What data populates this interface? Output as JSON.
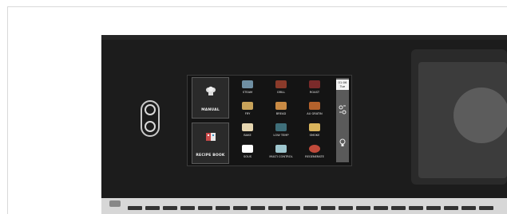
{
  "oven_panel": {
    "mode_buttons": [
      {
        "label": "MANUAL",
        "icon": "chef-hat-icon"
      },
      {
        "label": "RECIPE BOOK",
        "icon": "book-icon"
      }
    ],
    "programs": [
      {
        "label": "STEAM",
        "icon": "steam-icon",
        "color": "#6f8fa3"
      },
      {
        "label": "GRILL",
        "icon": "grill-icon",
        "color": "#8a3a2a"
      },
      {
        "label": "ROAST",
        "icon": "roast-icon",
        "color": "#7a2a2a"
      },
      {
        "label": "FRY",
        "icon": "fry-icon",
        "color": "#c8a35a"
      },
      {
        "label": "BREAD",
        "icon": "bread-icon",
        "color": "#c98a44"
      },
      {
        "label": "AU GRATIN",
        "icon": "au-gratin-icon",
        "color": "#b4622c"
      },
      {
        "label": "BAKE",
        "icon": "bake-icon",
        "color": "#e6d6b0"
      },
      {
        "label": "LOW TEMP",
        "icon": "low-temp-icon",
        "color": "#3f6f7a"
      },
      {
        "label": "SMOKE",
        "icon": "smoke-icon",
        "color": "#d9b45c"
      },
      {
        "label": "SOUS",
        "icon": "sous-icon",
        "color": "#ffffff"
      },
      {
        "label": "MULTI CONTROL",
        "icon": "multi-control-icon",
        "color": "#9fc7cf"
      },
      {
        "label": "REGENERATE",
        "icon": "regenerate-icon",
        "color": "#c04a3a"
      }
    ],
    "sidebar": {
      "time": "01:06",
      "day": "Tue",
      "icons": [
        "settings-icon",
        "lightbulb-icon"
      ]
    }
  }
}
